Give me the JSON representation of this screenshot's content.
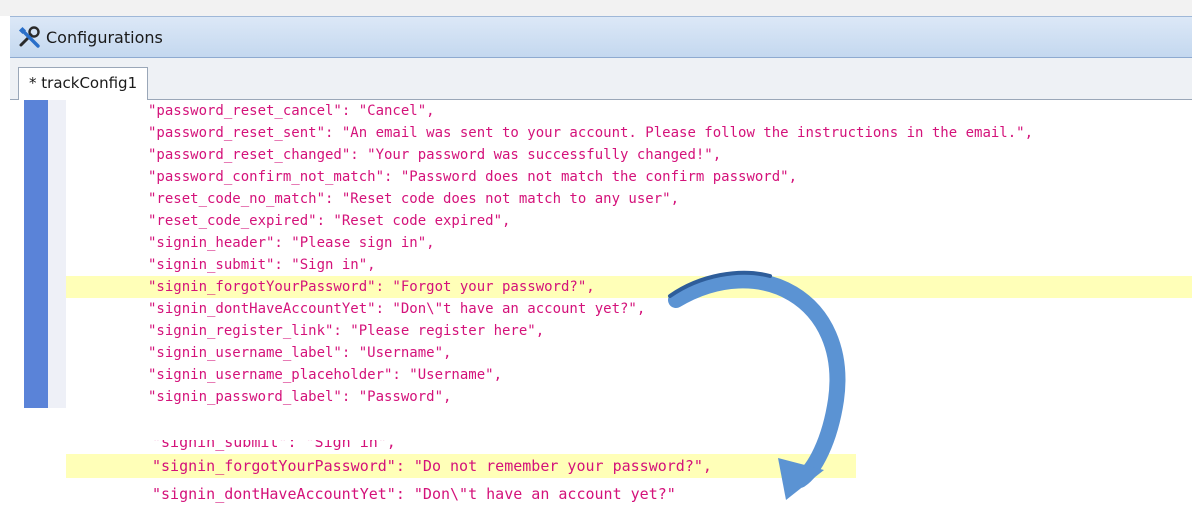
{
  "window": {
    "title": "Configurations",
    "title_icon": "tools-icon"
  },
  "tabs": [
    {
      "label": "* trackConfig1",
      "active": true
    }
  ],
  "editor": {
    "lines": [
      "\"password_reset_cancel\": \"Cancel\",",
      "\"password_reset_sent\": \"An email was sent to your account. Please follow the instructions in the email.\",",
      "\"password_reset_changed\": \"Your password was successfully changed!\",",
      "\"password_confirm_not_match\": \"Password does not match the confirm password\",",
      "\"reset_code_no_match\": \"Reset code does not match to any user\",",
      "\"reset_code_expired\": \"Reset code expired\",",
      "\"signin_header\": \"Please sign in\",",
      "\"signin_submit\": \"Sign in\",",
      "\"signin_forgotYourPassword\": \"Forgot your password?\",",
      "\"signin_dontHaveAccountYet\": \"Don\\\"t have an account yet?\",",
      "\"signin_register_link\": \"Please register here\",",
      "\"signin_username_label\": \"Username\",",
      "\"signin_username_placeholder\": \"Username\",",
      "\"signin_password_label\": \"Password\","
    ],
    "highlighted_line_index": 8
  },
  "zoom_inset": {
    "lines": [
      "\"signin_submit\": \"Sign in\",",
      "\"signin_forgotYourPassword\": \"Do not remember your password?\",",
      "\"signin_dontHaveAccountYet\": \"Don\\\"t have an account yet?\""
    ],
    "highlighted_line_index": 1
  },
  "colors": {
    "code_text": "#d4127a",
    "line_highlight": "#ffffb8",
    "gutter": "#5a83d8",
    "arrow": "#5b93d3"
  }
}
